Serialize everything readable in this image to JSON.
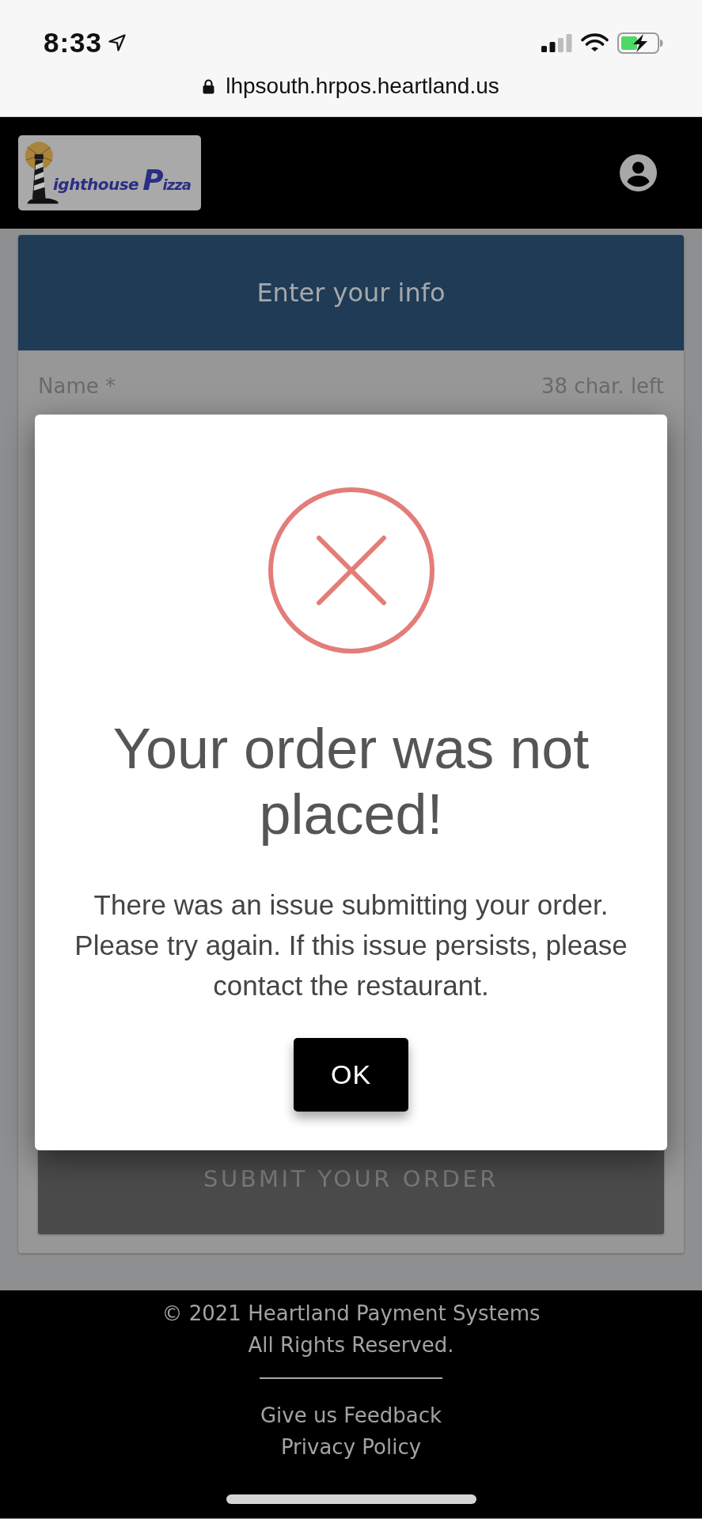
{
  "status_bar": {
    "time": "8:33"
  },
  "address_bar": {
    "url": "lhpsouth.hrpos.heartland.us"
  },
  "header": {
    "logo": {
      "word_1": "ighthouse",
      "word_2": "Pizza"
    }
  },
  "form": {
    "title": "Enter your info",
    "fields": [
      {
        "label": "Name *",
        "counter": "38 char. left"
      }
    ],
    "submit_button": "SUBMIT YOUR ORDER"
  },
  "dialog": {
    "title": "Your order was not placed!",
    "message": "There was an issue submitting your order. Please try again. If this issue persists, please contact the restaurant.",
    "buttons": [
      "OK"
    ]
  },
  "footer": {
    "copyright": "© 2021 Heartland Payment Systems",
    "rights": "All Rights Reserved.",
    "links": [
      "Give us Feedback",
      "Privacy Policy"
    ]
  }
}
